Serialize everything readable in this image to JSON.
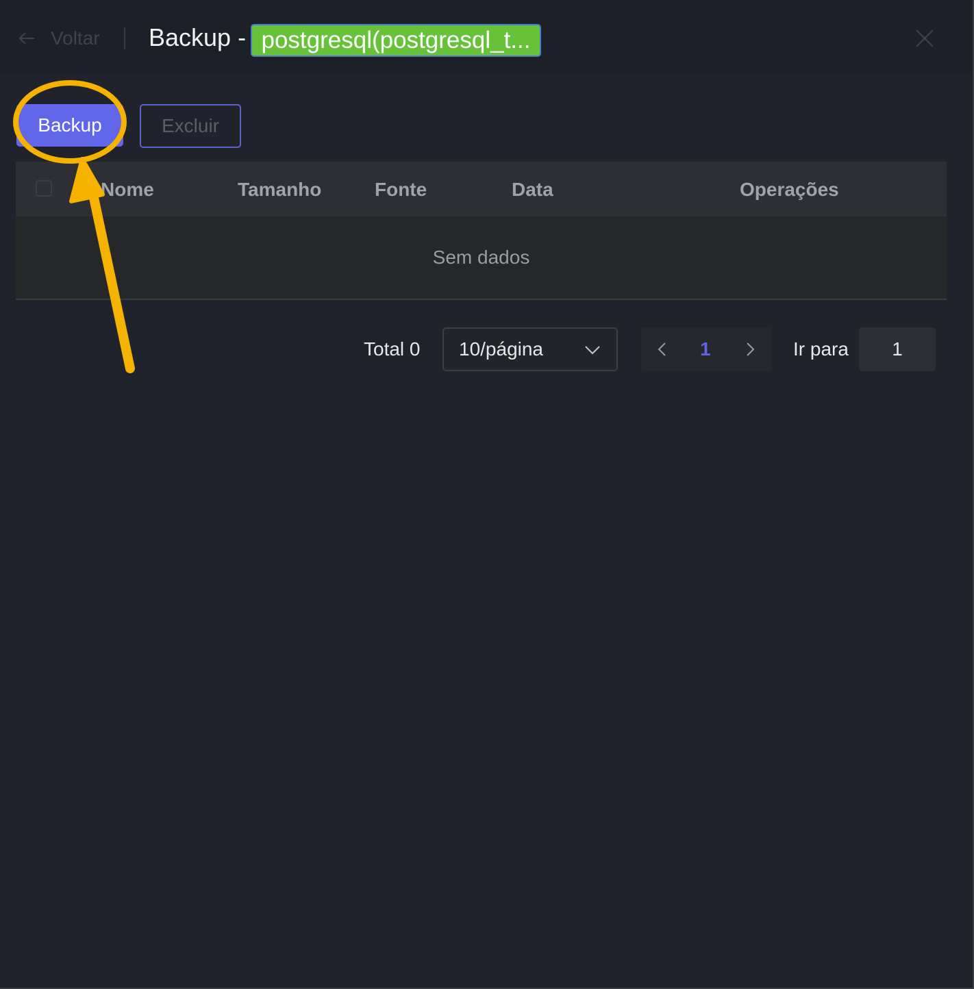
{
  "header": {
    "back_label": "Voltar",
    "title": "Backup -",
    "db_tag": "postgresql(postgresql_t..."
  },
  "toolbar": {
    "backup_label": "Backup",
    "delete_label": "Excluir"
  },
  "table": {
    "columns": [
      "Nome",
      "Tamanho",
      "Fonte",
      "Data",
      "Operações"
    ],
    "empty_text": "Sem dados"
  },
  "pagination": {
    "total": "Total 0",
    "page_size": "10/página",
    "current_page": "1",
    "goto_label": "Ir para",
    "goto_value": "1"
  },
  "colors": {
    "primary": "#6167e8",
    "tag_green": "#67c23a",
    "annotation": "#f5b300",
    "background": "#21232c"
  },
  "icons": [
    "arrow-left-icon",
    "close-icon",
    "chevron-down-icon",
    "chevron-left-icon",
    "chevron-right-icon"
  ]
}
